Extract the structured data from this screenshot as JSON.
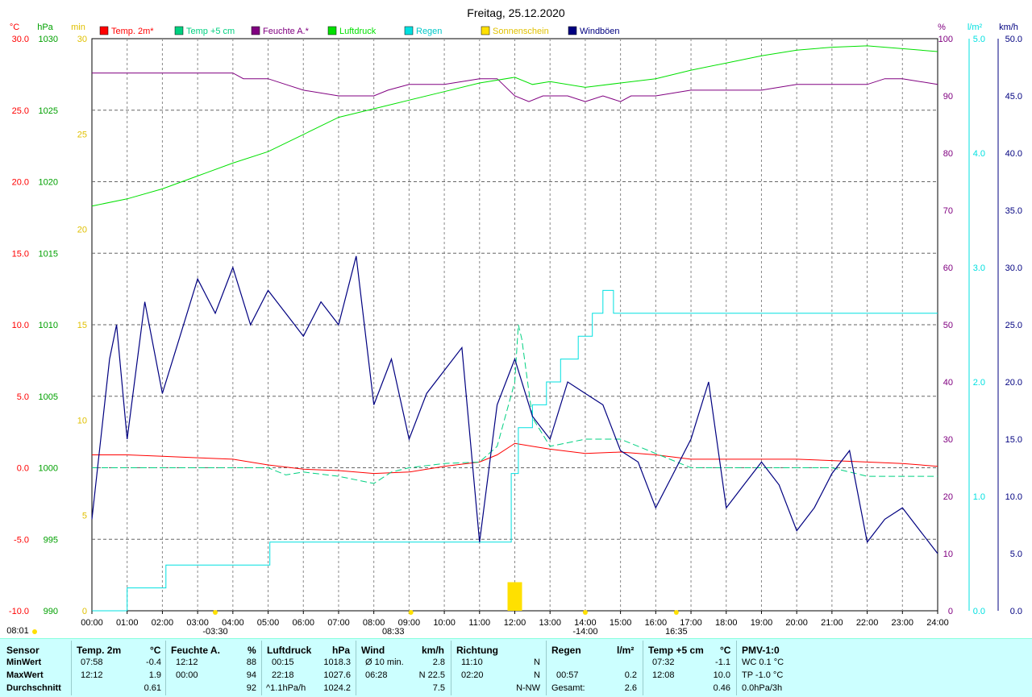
{
  "chart_data": {
    "type": "line",
    "title": "Freitag, 25.12.2020",
    "x_ticks": [
      "00:00",
      "01:00",
      "02:00",
      "03:00",
      "04:00",
      "05:00",
      "06:00",
      "07:00",
      "08:00",
      "09:00",
      "10:00",
      "11:00",
      "12:00",
      "13:00",
      "14:00",
      "15:00",
      "16:00",
      "17:00",
      "18:00",
      "19:00",
      "20:00",
      "21:00",
      "22:00",
      "23:00",
      "24:00"
    ],
    "xlim": [
      0,
      24
    ],
    "axes": {
      "temp": {
        "unit": "°C",
        "range": [
          -10,
          30
        ],
        "ticks": [
          "30.0",
          "25.0",
          "20.0",
          "15.0",
          "10.0",
          "5.0",
          "0.0",
          "-5.0",
          "-10.0"
        ],
        "color": "#ff0000"
      },
      "pressure": {
        "unit": "hPa",
        "range": [
          990,
          1030
        ],
        "ticks": [
          "1030",
          "1025",
          "1020",
          "1015",
          "1010",
          "1005",
          "1000",
          "995",
          "990"
        ],
        "color": "#00a000"
      },
      "sunshine": {
        "unit": "min",
        "range": [
          0,
          30
        ],
        "ticks": [
          "30",
          "25",
          "20",
          "15",
          "10",
          "5",
          "0"
        ],
        "color": "#e0c000"
      },
      "humidity": {
        "unit": "%",
        "range": [
          0,
          100
        ],
        "ticks": [
          "100",
          "90",
          "80",
          "70",
          "60",
          "50",
          "40",
          "30",
          "20",
          "10",
          "0"
        ],
        "color": "#800080"
      },
      "rain": {
        "unit": "l/m²",
        "range": [
          0,
          5
        ],
        "ticks": [
          "5.0",
          "4.0",
          "3.0",
          "2.0",
          "1.0",
          "0.0"
        ],
        "color": "#00e0e0"
      },
      "wind": {
        "unit": "km/h",
        "range": [
          0,
          50
        ],
        "ticks": [
          "50.0",
          "45.0",
          "40.0",
          "35.0",
          "30.0",
          "25.0",
          "20.0",
          "15.0",
          "10.0",
          "5.0",
          "0.0"
        ],
        "color": "#000080"
      }
    },
    "legend": [
      {
        "name": "Temp. 2m*",
        "color": "#ff0000"
      },
      {
        "name": "Temp +5 cm",
        "color": "#00d080"
      },
      {
        "name": "Feuchte A.*",
        "color": "#800080"
      },
      {
        "name": "Luftdruck",
        "color": "#00e000"
      },
      {
        "name": "Regen",
        "color": "#00e0e0"
      },
      {
        "name": "Sonnenschein",
        "color": "#ffe000"
      },
      {
        "name": "Windböen",
        "color": "#000080"
      }
    ],
    "series": [
      {
        "name": "Temp. 2m*",
        "axis": "temp",
        "x": [
          0,
          1,
          2,
          3,
          4,
          5,
          6,
          7,
          8,
          9,
          10,
          11,
          11.5,
          12,
          12.5,
          13,
          14,
          15,
          16,
          17,
          18,
          19,
          20,
          21,
          22,
          23,
          24
        ],
        "values": [
          0.9,
          0.9,
          0.8,
          0.7,
          0.6,
          0.2,
          -0.1,
          -0.2,
          -0.4,
          -0.3,
          0.1,
          0.4,
          0.9,
          1.7,
          1.5,
          1.3,
          1.0,
          1.1,
          0.9,
          0.6,
          0.6,
          0.6,
          0.6,
          0.5,
          0.4,
          0.3,
          0.1
        ]
      },
      {
        "name": "Temp +5 cm",
        "axis": "temp",
        "x": [
          0,
          1,
          2,
          3,
          4,
          5,
          5.5,
          6,
          7,
          8,
          8.5,
          9,
          10,
          11,
          11.5,
          12,
          12.1,
          12.2,
          12.5,
          13,
          14,
          15,
          16,
          17,
          18,
          19,
          20,
          21,
          22,
          23,
          24
        ],
        "values": [
          0.0,
          0.0,
          0.0,
          0.0,
          0.0,
          0.0,
          -0.5,
          -0.3,
          -0.6,
          -1.1,
          -0.3,
          0.0,
          0.3,
          0.4,
          1.5,
          6.0,
          10.0,
          9.0,
          3.5,
          1.5,
          2.0,
          2.0,
          1.0,
          0.0,
          0.0,
          0.0,
          0.0,
          0.0,
          -0.6,
          -0.6,
          -0.6
        ]
      },
      {
        "name": "Feuchte A.*",
        "axis": "humidity",
        "x": [
          0,
          4,
          4.3,
          5,
          5.5,
          6,
          7,
          8,
          8.4,
          9,
          10,
          11,
          11.5,
          12,
          12.4,
          12.8,
          13,
          13.5,
          14,
          14.5,
          15,
          15.3,
          16,
          17,
          18,
          19,
          20,
          21,
          22,
          22.5,
          23,
          24
        ],
        "values": [
          94,
          94,
          93,
          93,
          92,
          91,
          90,
          90,
          91,
          92,
          92,
          93,
          93,
          90,
          89,
          90,
          90,
          90,
          89,
          90,
          89,
          90,
          90,
          91,
          91,
          91,
          92,
          92,
          92,
          93,
          93,
          92
        ]
      },
      {
        "name": "Luftdruck",
        "axis": "pressure",
        "x": [
          0,
          1,
          2,
          3,
          4,
          5,
          6,
          7,
          8,
          9,
          10,
          11,
          12,
          12.5,
          13,
          14,
          15,
          16,
          17,
          18,
          19,
          20,
          21,
          22,
          23,
          24
        ],
        "values": [
          1018.3,
          1018.8,
          1019.5,
          1020.4,
          1021.3,
          1022.1,
          1023.3,
          1024.5,
          1025.1,
          1025.7,
          1026.3,
          1026.9,
          1027.3,
          1026.8,
          1027.0,
          1026.6,
          1026.9,
          1027.2,
          1027.8,
          1028.3,
          1028.8,
          1029.2,
          1029.4,
          1029.5,
          1029.3,
          1029.1
        ]
      },
      {
        "name": "Regen",
        "axis": "rain",
        "cumulative": true,
        "x": [
          0,
          0.95,
          1,
          2.05,
          2.1,
          5,
          5.05,
          11.8,
          11.9,
          12.1,
          12.5,
          12.9,
          13.3,
          13.8,
          14.2,
          14.5,
          14.8,
          24
        ],
        "values": [
          0,
          0,
          0.2,
          0.2,
          0.4,
          0.4,
          0.6,
          0.6,
          1.2,
          1.6,
          1.8,
          2.0,
          2.2,
          2.4,
          2.6,
          2.8,
          2.6,
          2.6
        ]
      },
      {
        "name": "Sonnenschein",
        "axis": "sunshine",
        "bars": [
          {
            "x": 12.0,
            "values": [
              1.5
            ]
          }
        ]
      },
      {
        "name": "Windböen",
        "axis": "wind",
        "x": [
          0,
          0.5,
          0.7,
          1,
          1.5,
          2,
          2.5,
          3,
          3.5,
          4,
          4.5,
          5,
          5.5,
          6,
          6.5,
          7,
          7.5,
          8,
          8.5,
          9,
          9.5,
          10,
          10.5,
          11,
          11.5,
          12,
          12.5,
          13,
          13.5,
          14,
          14.5,
          15,
          15.5,
          16,
          16.5,
          17,
          17.5,
          18,
          18.5,
          19,
          19.5,
          20,
          20.5,
          21,
          21.5,
          22,
          22.5,
          23,
          23.5,
          24
        ],
        "values": [
          8,
          22,
          25,
          15,
          27,
          19,
          24,
          29,
          26,
          30,
          25,
          28,
          26,
          24,
          27,
          25,
          31,
          18,
          22,
          15,
          19,
          21,
          23,
          6,
          18,
          22,
          17,
          15,
          20,
          19,
          18,
          14,
          13,
          9,
          12,
          15,
          20,
          9,
          11,
          13,
          11,
          7,
          9,
          12,
          14,
          6,
          8,
          9,
          7,
          5
        ]
      }
    ],
    "markers": [
      {
        "time": "03:30",
        "label": "-03:30"
      },
      {
        "time": "08:33",
        "label": "08:33"
      },
      {
        "time": "14:00",
        "label": "-14:00"
      },
      {
        "time": "16:35",
        "label": "16:35"
      },
      {
        "time": "08:01",
        "label": "08:01"
      }
    ]
  },
  "stats": {
    "headers": {
      "sensor": "Sensor",
      "temp2m": "Temp. 2m",
      "temp2m_unit": "°C",
      "feuchte": "Feuchte A.",
      "feuchte_unit": "%",
      "luftdruck": "Luftdruck",
      "luftdruck_unit": "hPa",
      "wind": "Wind",
      "wind_unit": "km/h",
      "richtung": "Richtung",
      "regen": "Regen",
      "regen_unit": "l/m²",
      "temp5": "Temp +5 cm",
      "temp5_unit": "°C",
      "pmv": "PMV-1:0"
    },
    "rows": {
      "min": {
        "label": "MinWert",
        "t2_time": "07:58",
        "t2_val": "-0.4",
        "f_time": "12:12",
        "f_val": "88",
        "p_time": "00:15",
        "p_val": "1018.3",
        "w_time": "Ø 10 min.",
        "w_val": "2.8",
        "r_time": "11:10",
        "r_dir": "N",
        "rg_time": "",
        "rg_val": "",
        "t5_time": "07:32",
        "t5_val": "-1.1",
        "pmv": "WC 0.1 °C"
      },
      "max": {
        "label": "MaxWert",
        "t2_time": "12:12",
        "t2_val": "1.9",
        "f_time": "00:00",
        "f_val": "94",
        "p_time": "22:18",
        "p_val": "1027.6",
        "w_time": "06:28",
        "w_val": "N 22.5",
        "r_time": "02:20",
        "r_dir": "N",
        "rg_time": "00:57",
        "rg_val": "0.2",
        "t5_time": "12:08",
        "t5_val": "10.0",
        "pmv": "TP -1.0 °C"
      },
      "avg": {
        "label": "Durchschnitt",
        "t2_time": "",
        "t2_val": "0.61",
        "f_time": "",
        "f_val": "92",
        "p_time": "^1.1hPa/h",
        "p_val": "1024.2",
        "w_time": "",
        "w_val": "7.5",
        "r_time": "",
        "r_dir": "N-NW",
        "rg_time": "Gesamt:",
        "rg_val": "2.6",
        "t5_time": "",
        "t5_val": "0.46",
        "pmv": "0.0hPa/3h"
      }
    }
  }
}
